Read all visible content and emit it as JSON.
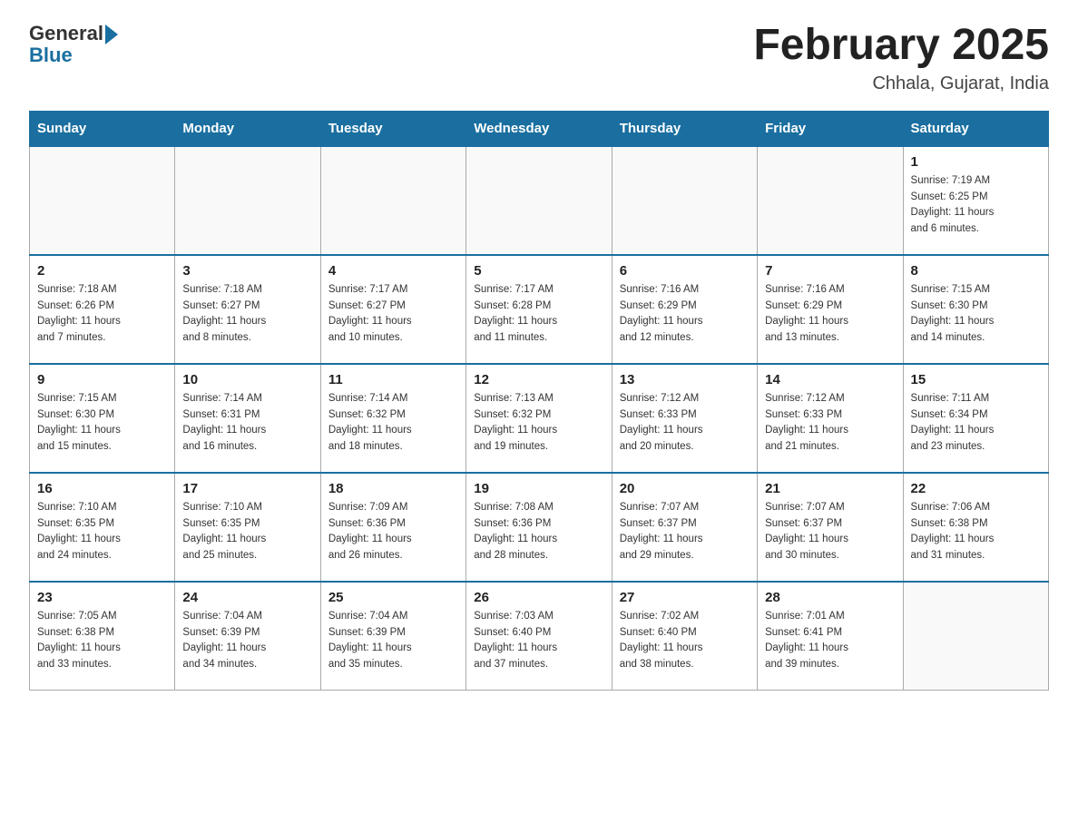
{
  "header": {
    "logo_general": "General",
    "logo_blue": "Blue",
    "month_title": "February 2025",
    "location": "Chhala, Gujarat, India"
  },
  "days_of_week": [
    "Sunday",
    "Monday",
    "Tuesday",
    "Wednesday",
    "Thursday",
    "Friday",
    "Saturday"
  ],
  "weeks": [
    [
      {
        "num": "",
        "info": ""
      },
      {
        "num": "",
        "info": ""
      },
      {
        "num": "",
        "info": ""
      },
      {
        "num": "",
        "info": ""
      },
      {
        "num": "",
        "info": ""
      },
      {
        "num": "",
        "info": ""
      },
      {
        "num": "1",
        "info": "Sunrise: 7:19 AM\nSunset: 6:25 PM\nDaylight: 11 hours\nand 6 minutes."
      }
    ],
    [
      {
        "num": "2",
        "info": "Sunrise: 7:18 AM\nSunset: 6:26 PM\nDaylight: 11 hours\nand 7 minutes."
      },
      {
        "num": "3",
        "info": "Sunrise: 7:18 AM\nSunset: 6:27 PM\nDaylight: 11 hours\nand 8 minutes."
      },
      {
        "num": "4",
        "info": "Sunrise: 7:17 AM\nSunset: 6:27 PM\nDaylight: 11 hours\nand 10 minutes."
      },
      {
        "num": "5",
        "info": "Sunrise: 7:17 AM\nSunset: 6:28 PM\nDaylight: 11 hours\nand 11 minutes."
      },
      {
        "num": "6",
        "info": "Sunrise: 7:16 AM\nSunset: 6:29 PM\nDaylight: 11 hours\nand 12 minutes."
      },
      {
        "num": "7",
        "info": "Sunrise: 7:16 AM\nSunset: 6:29 PM\nDaylight: 11 hours\nand 13 minutes."
      },
      {
        "num": "8",
        "info": "Sunrise: 7:15 AM\nSunset: 6:30 PM\nDaylight: 11 hours\nand 14 minutes."
      }
    ],
    [
      {
        "num": "9",
        "info": "Sunrise: 7:15 AM\nSunset: 6:30 PM\nDaylight: 11 hours\nand 15 minutes."
      },
      {
        "num": "10",
        "info": "Sunrise: 7:14 AM\nSunset: 6:31 PM\nDaylight: 11 hours\nand 16 minutes."
      },
      {
        "num": "11",
        "info": "Sunrise: 7:14 AM\nSunset: 6:32 PM\nDaylight: 11 hours\nand 18 minutes."
      },
      {
        "num": "12",
        "info": "Sunrise: 7:13 AM\nSunset: 6:32 PM\nDaylight: 11 hours\nand 19 minutes."
      },
      {
        "num": "13",
        "info": "Sunrise: 7:12 AM\nSunset: 6:33 PM\nDaylight: 11 hours\nand 20 minutes."
      },
      {
        "num": "14",
        "info": "Sunrise: 7:12 AM\nSunset: 6:33 PM\nDaylight: 11 hours\nand 21 minutes."
      },
      {
        "num": "15",
        "info": "Sunrise: 7:11 AM\nSunset: 6:34 PM\nDaylight: 11 hours\nand 23 minutes."
      }
    ],
    [
      {
        "num": "16",
        "info": "Sunrise: 7:10 AM\nSunset: 6:35 PM\nDaylight: 11 hours\nand 24 minutes."
      },
      {
        "num": "17",
        "info": "Sunrise: 7:10 AM\nSunset: 6:35 PM\nDaylight: 11 hours\nand 25 minutes."
      },
      {
        "num": "18",
        "info": "Sunrise: 7:09 AM\nSunset: 6:36 PM\nDaylight: 11 hours\nand 26 minutes."
      },
      {
        "num": "19",
        "info": "Sunrise: 7:08 AM\nSunset: 6:36 PM\nDaylight: 11 hours\nand 28 minutes."
      },
      {
        "num": "20",
        "info": "Sunrise: 7:07 AM\nSunset: 6:37 PM\nDaylight: 11 hours\nand 29 minutes."
      },
      {
        "num": "21",
        "info": "Sunrise: 7:07 AM\nSunset: 6:37 PM\nDaylight: 11 hours\nand 30 minutes."
      },
      {
        "num": "22",
        "info": "Sunrise: 7:06 AM\nSunset: 6:38 PM\nDaylight: 11 hours\nand 31 minutes."
      }
    ],
    [
      {
        "num": "23",
        "info": "Sunrise: 7:05 AM\nSunset: 6:38 PM\nDaylight: 11 hours\nand 33 minutes."
      },
      {
        "num": "24",
        "info": "Sunrise: 7:04 AM\nSunset: 6:39 PM\nDaylight: 11 hours\nand 34 minutes."
      },
      {
        "num": "25",
        "info": "Sunrise: 7:04 AM\nSunset: 6:39 PM\nDaylight: 11 hours\nand 35 minutes."
      },
      {
        "num": "26",
        "info": "Sunrise: 7:03 AM\nSunset: 6:40 PM\nDaylight: 11 hours\nand 37 minutes."
      },
      {
        "num": "27",
        "info": "Sunrise: 7:02 AM\nSunset: 6:40 PM\nDaylight: 11 hours\nand 38 minutes."
      },
      {
        "num": "28",
        "info": "Sunrise: 7:01 AM\nSunset: 6:41 PM\nDaylight: 11 hours\nand 39 minutes."
      },
      {
        "num": "",
        "info": ""
      }
    ]
  ]
}
